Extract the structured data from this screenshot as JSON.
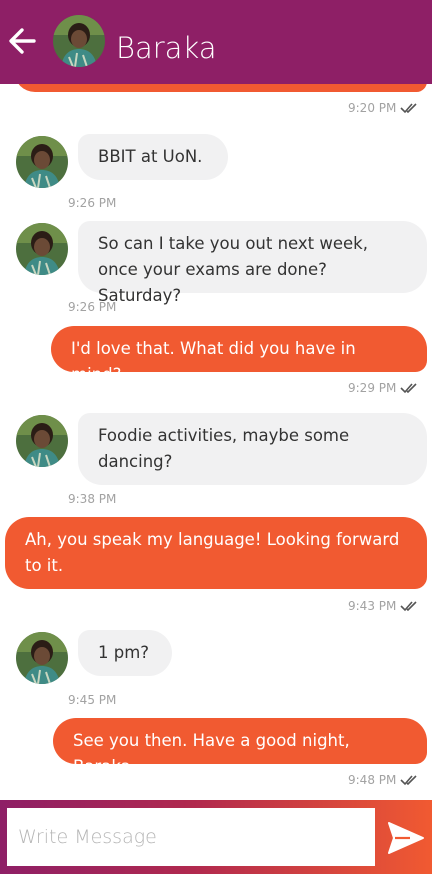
{
  "header": {
    "title": "Baraka",
    "back_icon": "arrow-left-icon",
    "color": "#8e1f66"
  },
  "messages": [
    {
      "dir": "out",
      "text": "",
      "time": "9:20 PM",
      "status": "read"
    },
    {
      "dir": "in",
      "text": "BBIT at UoN.",
      "time": "9:26 PM"
    },
    {
      "dir": "in",
      "text": "So can I take you out next week, once your exams are done? Saturday?",
      "time": "9:26 PM"
    },
    {
      "dir": "out",
      "text": "I'd love that. What did you have in mind?",
      "time": "9:29 PM",
      "status": "read"
    },
    {
      "dir": "in",
      "text": "Foodie activities, maybe some dancing?",
      "time": "9:38 PM"
    },
    {
      "dir": "out",
      "text": "Ah, you speak my language! Looking forward to it.",
      "time": "9:43 PM",
      "status": "read"
    },
    {
      "dir": "in",
      "text": "1 pm?",
      "time": "9:45 PM"
    },
    {
      "dir": "out",
      "text": "See you then. Have a good night, Baraka",
      "time": "9:48 PM",
      "status": "read"
    }
  ],
  "composer": {
    "placeholder": "Write Message",
    "value": "",
    "send_icon": "send-icon"
  },
  "colors": {
    "outgoing_bubble": "#f15a31",
    "incoming_bubble": "#f1f1f2",
    "timestamp": "#a2a2a2"
  }
}
